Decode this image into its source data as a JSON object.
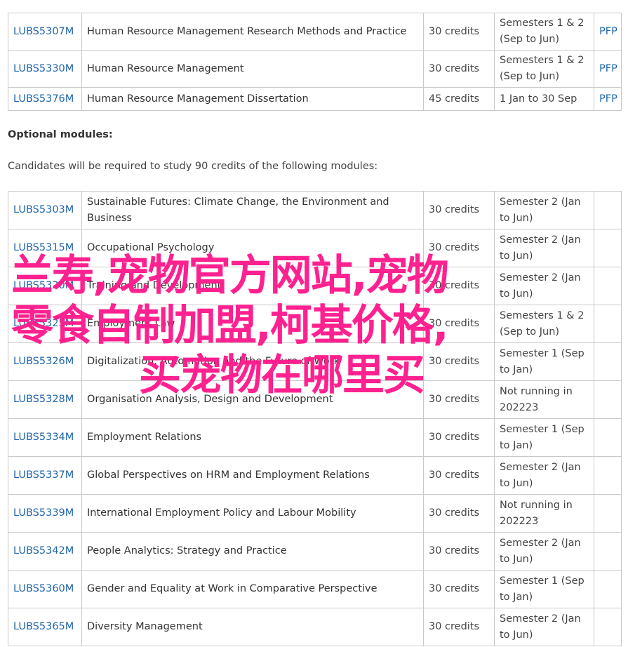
{
  "core_modules": [
    {
      "code": "LUBS5307M",
      "title": "Human Resource Management Research Methods and Practice",
      "credits": "30 credits",
      "semester": "Semesters 1 & 2 (Sep to Jun)",
      "pfp": "PFP"
    },
    {
      "code": "LUBS5330M",
      "title": "Human Resource Management",
      "credits": "30 credits",
      "semester": "Semesters 1 & 2 (Sep to Jun)",
      "pfp": "PFP"
    },
    {
      "code": "LUBS5376M",
      "title": "Human Resource Management Dissertation",
      "credits": "45 credits",
      "semester": "1 Jan to 30 Sep",
      "pfp": "PFP"
    }
  ],
  "optional_heading": "Optional modules:",
  "optional_intro": "Candidates will be required to study 90 credits of the following modules:",
  "optional_modules": [
    {
      "code": "LUBS5303M",
      "title": "Sustainable Futures: Climate Change, the Environment and Business",
      "credits": "30 credits",
      "semester": "Semester 2 (Jan to Jun)"
    },
    {
      "code": "LUBS5315M",
      "title": "Occupational Psychology",
      "credits": "30 credits",
      "semester": "Semester 2 (Jan to Jun)"
    },
    {
      "code": "LUBS5320M",
      "title": "Training and Development",
      "credits": "30 credits",
      "semester": "Semester 2 (Jan to Jun)"
    },
    {
      "code": "LUBS5325M",
      "title": "Employment Law",
      "credits": "30 credits",
      "semester": "Semesters 1 & 2 (Sep to Jun)"
    },
    {
      "code": "LUBS5326M",
      "title": "Digitalization, Automation and the Future of Work",
      "credits": "30 credits",
      "semester": "Semester 1 (Sep to Jan)"
    },
    {
      "code": "LUBS5328M",
      "title": "Organisation Analysis, Design and Development",
      "credits": "30 credits",
      "semester": "Not running in 202223"
    },
    {
      "code": "LUBS5334M",
      "title": "Employment Relations",
      "credits": "30 credits",
      "semester": "Semester 1 (Sep to Jan)"
    },
    {
      "code": "LUBS5337M",
      "title": "Global Perspectives on HRM and Employment Relations",
      "credits": "30 credits",
      "semester": "Semester 2 (Jan to Jun)"
    },
    {
      "code": "LUBS5339M",
      "title": "International Employment Policy and Labour Mobility",
      "credits": "30 credits",
      "semester": "Not running in 202223"
    },
    {
      "code": "LUBS5342M",
      "title": "People Analytics: Strategy and Practice",
      "credits": "30 credits",
      "semester": "Semester 2 (Jan to Jun)"
    },
    {
      "code": "LUBS5360M",
      "title": "Gender and Equality at Work in Comparative Perspective",
      "credits": "30 credits",
      "semester": "Semester 1 (Sep to Jan)"
    },
    {
      "code": "LUBS5365M",
      "title": "Diversity Management",
      "credits": "30 credits",
      "semester": "Semester 2 (Jan to Jun)"
    }
  ],
  "watermark_lines": [
    "兰寿,宠物官方网站,宠物",
    "零食自制加盟,柯基价格,",
    "买宠物在哪里买"
  ],
  "colors": {
    "link": "#2266aa",
    "watermark": "#ff1a8c",
    "border": "#c9c9c9"
  }
}
